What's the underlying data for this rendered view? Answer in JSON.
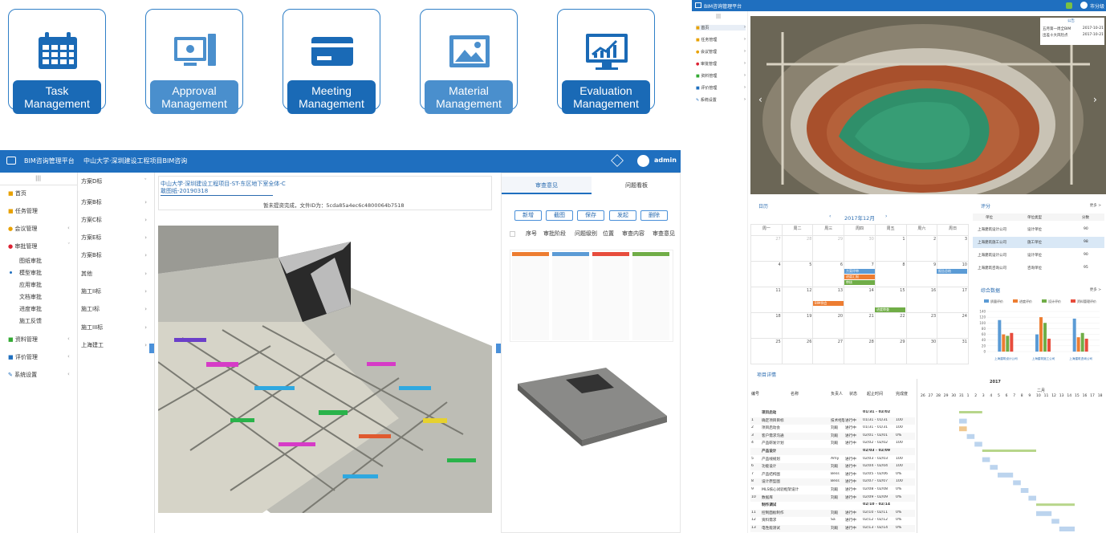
{
  "modules": [
    {
      "title": "Task\nManagement",
      "l1": "Task",
      "l2": "Management",
      "color": "#1a6ab6",
      "icon": "calendar-icon"
    },
    {
      "title": "Approval Management",
      "l1": "Approval",
      "l2": "Management",
      "color": "#4a8fcd",
      "icon": "computer-approval-icon"
    },
    {
      "title": "Meeting Management",
      "l1": "Meeting",
      "l2": "Management",
      "color": "#1a6ab6",
      "icon": "card-icon"
    },
    {
      "title": "Material Management",
      "l1": "Material",
      "l2": "Management",
      "color": "#4a8fcd",
      "icon": "image-icon"
    },
    {
      "title": "Evaluation Management",
      "l1": "Evaluation",
      "l2": "Management",
      "color": "#1a6ab6",
      "icon": "chart-monitor-icon"
    }
  ],
  "left_app": {
    "brand": "BIM咨询管理平台",
    "project": "中山大学·深圳建设工程项目BIM咨询",
    "user": "admin",
    "collapse": "|||",
    "menu": [
      {
        "label": "首页",
        "icon": "home-icon"
      },
      {
        "label": "任务管理",
        "icon": "task-icon"
      },
      {
        "label": "会议管理",
        "icon": "meeting-icon"
      },
      {
        "label": "审批管理",
        "icon": "approval-icon"
      }
    ],
    "submenu": [
      "图纸审批",
      "模型审批",
      "应用审批",
      "文档审批",
      "进度审批",
      "施工反馈"
    ],
    "menu2": [
      {
        "label": "资料管理"
      },
      {
        "label": "评价管理"
      },
      {
        "label": "系统设置"
      }
    ],
    "col2": [
      "方案D标",
      "方案B标",
      "方案C标",
      "方案E标",
      "方案B标",
      "其他",
      "施工II标",
      "施工I标",
      "施工III标",
      "上海建工"
    ],
    "file_title": "中山大学·深圳建设工程项目-ST-东区地下室全体-C",
    "file_title2": "敢图纸-20190318",
    "loaded": "暂未提资完成，文件ID为：5cda85a4ec6c4800064b7518",
    "tabs": [
      "审查意见",
      "问题看板"
    ],
    "buttons": [
      "新增",
      "截图",
      "保存",
      "发起",
      "删除"
    ],
    "cols": [
      "序号",
      "审批阶段",
      "问题级别",
      "位置",
      "审查内容",
      "审查意见"
    ]
  },
  "right_app": {
    "brand": "BIM咨询管理平台",
    "user": "市分级",
    "menu": [
      "首页",
      "任务管理",
      "会议管理",
      "审批管理",
      "资料管理",
      "评价管理",
      "系统设置"
    ],
    "notice_title": "公告",
    "notices": [
      {
        "text": "五月第一周全BIM",
        "date": "2017-10-21"
      },
      {
        "text": "出差十大风险点",
        "date": "2017-10-21"
      }
    ],
    "calendar_title": "日历",
    "month": "2017年12月",
    "weekdays": [
      "周一",
      "周二",
      "周三",
      "周四",
      "周五",
      "周六",
      "周日"
    ],
    "weeks": [
      [
        "27",
        "28",
        "29",
        "30",
        "1",
        "2",
        "3"
      ],
      [
        "4",
        "5",
        "6",
        "7",
        "8",
        "9",
        "10"
      ],
      [
        "11",
        "12",
        "13",
        "14",
        "15",
        "16",
        "17"
      ],
      [
        "18",
        "19",
        "20",
        "21",
        "22",
        "23",
        "24"
      ],
      [
        "25",
        "26",
        "27",
        "28",
        "29",
        "30",
        "31"
      ]
    ],
    "events": [
      "方案评审",
      "进度汇报",
      "审核",
      "报告总结",
      "BIM例会",
      "进度审查"
    ],
    "rating_title": "评分",
    "more": "更多 >",
    "rating_head": [
      "单位",
      "单位类型",
      "分数"
    ],
    "ratings": [
      [
        "上海建筑设计公司",
        "设计单位",
        "90"
      ],
      [
        "上海建筑施工公司",
        "施工单位",
        "98"
      ],
      [
        "上海建筑设计公司",
        "设计单位",
        "90"
      ],
      [
        "上海建筑咨询公司",
        "咨询单位",
        "95"
      ]
    ],
    "stats_title": "综合数据",
    "gantt_title": "项目详情",
    "gantt_year": "2017",
    "gantt_month": "二月",
    "gantt_head": [
      "编号",
      "名称",
      "负责人",
      "状态",
      "起止时间",
      "完成度"
    ],
    "gantt_rows": [
      [
        "",
        "项目启动",
        "",
        "",
        "01/31 - 02/02",
        ""
      ],
      [
        "1",
        "确定项目目标",
        "技术经理",
        "进行中",
        "01/31 - 01/31",
        "100"
      ],
      [
        "2",
        "项目启动会",
        "刘殿",
        "进行中",
        "01/31 - 01/31",
        "100"
      ],
      [
        "3",
        "客户需求沟通",
        "刘殿",
        "进行中",
        "02/01 - 02/01",
        "0%"
      ],
      [
        "4",
        "产品研发计划",
        "刘殿",
        "进行中",
        "02/02 - 02/02",
        "100"
      ],
      [
        "",
        "产品设计",
        "",
        "",
        "02/03 - 02/09",
        ""
      ],
      [
        "5",
        "产品线规划",
        "Amy",
        "进行中",
        "02/03 - 02/03",
        "100"
      ],
      [
        "6",
        "功能设计",
        "刘殿",
        "进行中",
        "02/04 - 02/04",
        "100"
      ],
      [
        "7",
        "产品结构图",
        "Bess",
        "进行中",
        "02/05 - 02/06",
        "0%"
      ],
      [
        "8",
        "设计原型图",
        "Bess",
        "进行中",
        "02/07 - 02/07",
        "100"
      ],
      [
        "9",
        "MLS核心试验框架设计",
        "刘殿",
        "进行中",
        "02/08 - 02/08",
        "0%"
      ],
      [
        "10",
        "数据库",
        "刘殿",
        "进行中",
        "02/09 - 02/09",
        "0%"
      ],
      [
        "",
        "制作调试",
        "",
        "",
        "02/10 - 02/14",
        ""
      ],
      [
        "11",
        "控制面板制作",
        "刘殿",
        "进行中",
        "02/10 - 02/11",
        "0%"
      ],
      [
        "12",
        "资料需求",
        "Sa",
        "进行中",
        "02/12 - 02/12",
        "0%"
      ],
      [
        "13",
        "电性能测试",
        "刘殿",
        "进行中",
        "02/13 - 02/14",
        "0%"
      ]
    ]
  },
  "chart_data": {
    "type": "bar",
    "categories": [
      "上海建筑设计公司",
      "上海建筑施工公司",
      "上海建筑咨询公司"
    ],
    "series": [
      {
        "name": "质量评价",
        "values": [
          110,
          60,
          115
        ]
      },
      {
        "name": "进度评价",
        "values": [
          60,
          120,
          50
        ]
      },
      {
        "name": "设计评价",
        "values": [
          55,
          100,
          65
        ]
      },
      {
        "name": "资料管理评价",
        "values": [
          65,
          45,
          45
        ]
      }
    ],
    "ylim": [
      0,
      140
    ],
    "ticks": [
      "0",
      "20",
      "40",
      "60",
      "80",
      "100",
      "120",
      "140"
    ],
    "colors": [
      "#5b9bd5",
      "#ed7d31",
      "#70ad47",
      "#e74c3c"
    ]
  }
}
